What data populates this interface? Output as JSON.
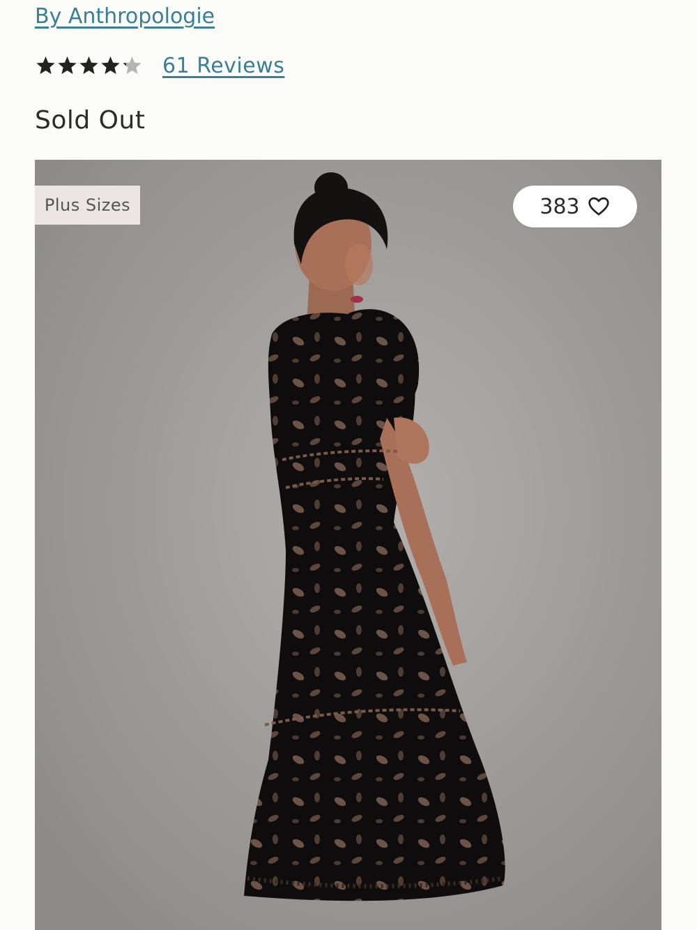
{
  "brand": {
    "link_text": "By Anthropologie"
  },
  "rating": {
    "stars": 4.5,
    "star_count": 5,
    "reviews_text": "61 Reviews"
  },
  "status": {
    "text": "Sold Out"
  },
  "product_image": {
    "badge_text": "Plus Sizes",
    "favorite_count": "383",
    "favorite_icon": "heart-outline-icon",
    "alt": "Model wearing black lace midi dress with puff sleeves"
  },
  "colors": {
    "link": "#3a7f93",
    "star_filled": "#222222",
    "star_empty": "#b5b5b5",
    "badge_bg": "#ebe6e3",
    "dress": "#0e0c0c"
  }
}
